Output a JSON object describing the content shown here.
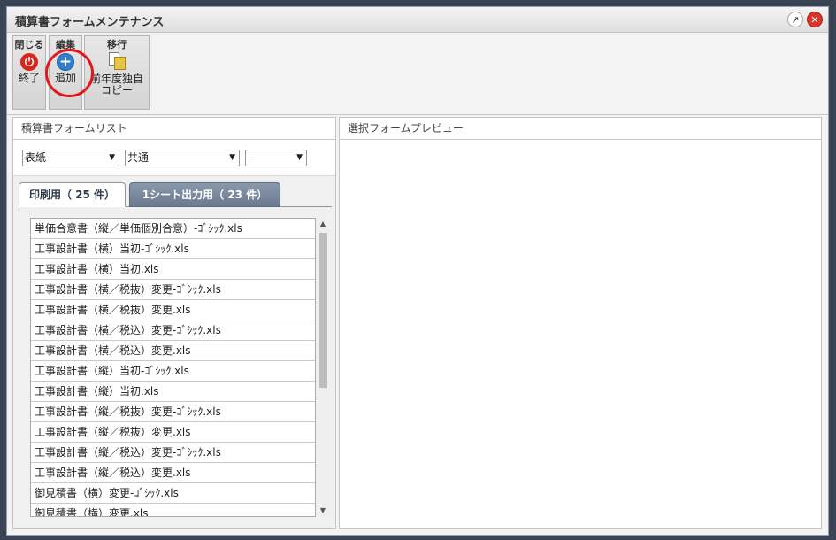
{
  "window": {
    "title": "積算書フォームメンテナンス"
  },
  "titlebar_icons": [
    "popout-icon",
    "close-icon"
  ],
  "toolbar": {
    "groups": [
      {
        "label": "閉じる",
        "button": {
          "label": "終了",
          "icon": "power-icon"
        }
      },
      {
        "label": "編集",
        "button": {
          "label": "追加",
          "icon": "plus-icon"
        }
      },
      {
        "label": "移行",
        "button": {
          "label_line1": "前年度独自",
          "label_line2": "コピー",
          "icon": "copy-icon"
        }
      }
    ]
  },
  "left_panel": {
    "title": "積算書フォームリスト",
    "filters": [
      {
        "value": "表紙"
      },
      {
        "value": "共通"
      },
      {
        "value": "-"
      }
    ],
    "tabs": [
      {
        "label": "印刷用（ 25 件）",
        "active": true
      },
      {
        "label": "1シート出力用（ 23 件）",
        "active": false
      }
    ],
    "list_items": [
      "単価合意書（縦／単価個別合意）-ｺﾞｼｯｸ.xls",
      "工事設計書（横）当初-ｺﾞｼｯｸ.xls",
      "工事設計書（横）当初.xls",
      "工事設計書（横／税抜）変更-ｺﾞｼｯｸ.xls",
      "工事設計書（横／税抜）変更.xls",
      "工事設計書（横／税込）変更-ｺﾞｼｯｸ.xls",
      "工事設計書（横／税込）変更.xls",
      "工事設計書（縦）当初-ｺﾞｼｯｸ.xls",
      "工事設計書（縦）当初.xls",
      "工事設計書（縦／税抜）変更-ｺﾞｼｯｸ.xls",
      "工事設計書（縦／税抜）変更.xls",
      "工事設計書（縦／税込）変更-ｺﾞｼｯｸ.xls",
      "工事設計書（縦／税込）変更.xls",
      "御見積書（横）変更-ｺﾞｼｯｸ.xls",
      "御見積書（横）変更.xls"
    ]
  },
  "right_panel": {
    "title": "選択フォームプレビュー"
  },
  "colors": {
    "accent_ring": "#e3181b",
    "tab_inactive": "#6b7a90",
    "close_button": "#d9352a"
  }
}
